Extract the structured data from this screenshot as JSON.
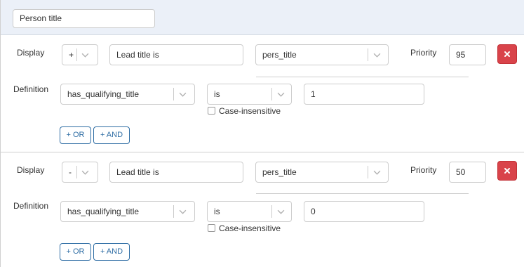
{
  "header": {
    "title_value": "Person title"
  },
  "rules": [
    {
      "display_label": "Display",
      "sign": "+",
      "display_text": "Lead title is",
      "field": "pers_title",
      "priority_label": "Priority",
      "priority": "95",
      "definition_label": "Definition",
      "condition_field": "has_qualifying_title",
      "operator": "is",
      "value": "1",
      "case_insensitive_label": "Case-insensitive",
      "or_label": "+ OR",
      "and_label": "+ AND"
    },
    {
      "display_label": "Display",
      "sign": "-",
      "display_text": "Lead title is",
      "field": "pers_title",
      "priority_label": "Priority",
      "priority": "50",
      "definition_label": "Definition",
      "condition_field": "has_qualifying_title",
      "operator": "is",
      "value": "0",
      "case_insensitive_label": "Case-insensitive",
      "or_label": "+ OR",
      "and_label": "+ AND"
    }
  ],
  "colors": {
    "delete": "#d9434a",
    "accent": "#2e6da4",
    "header_bg": "#ebf0f8"
  },
  "icons": {
    "delete": "close-icon",
    "select": "chevron-down-icon"
  }
}
